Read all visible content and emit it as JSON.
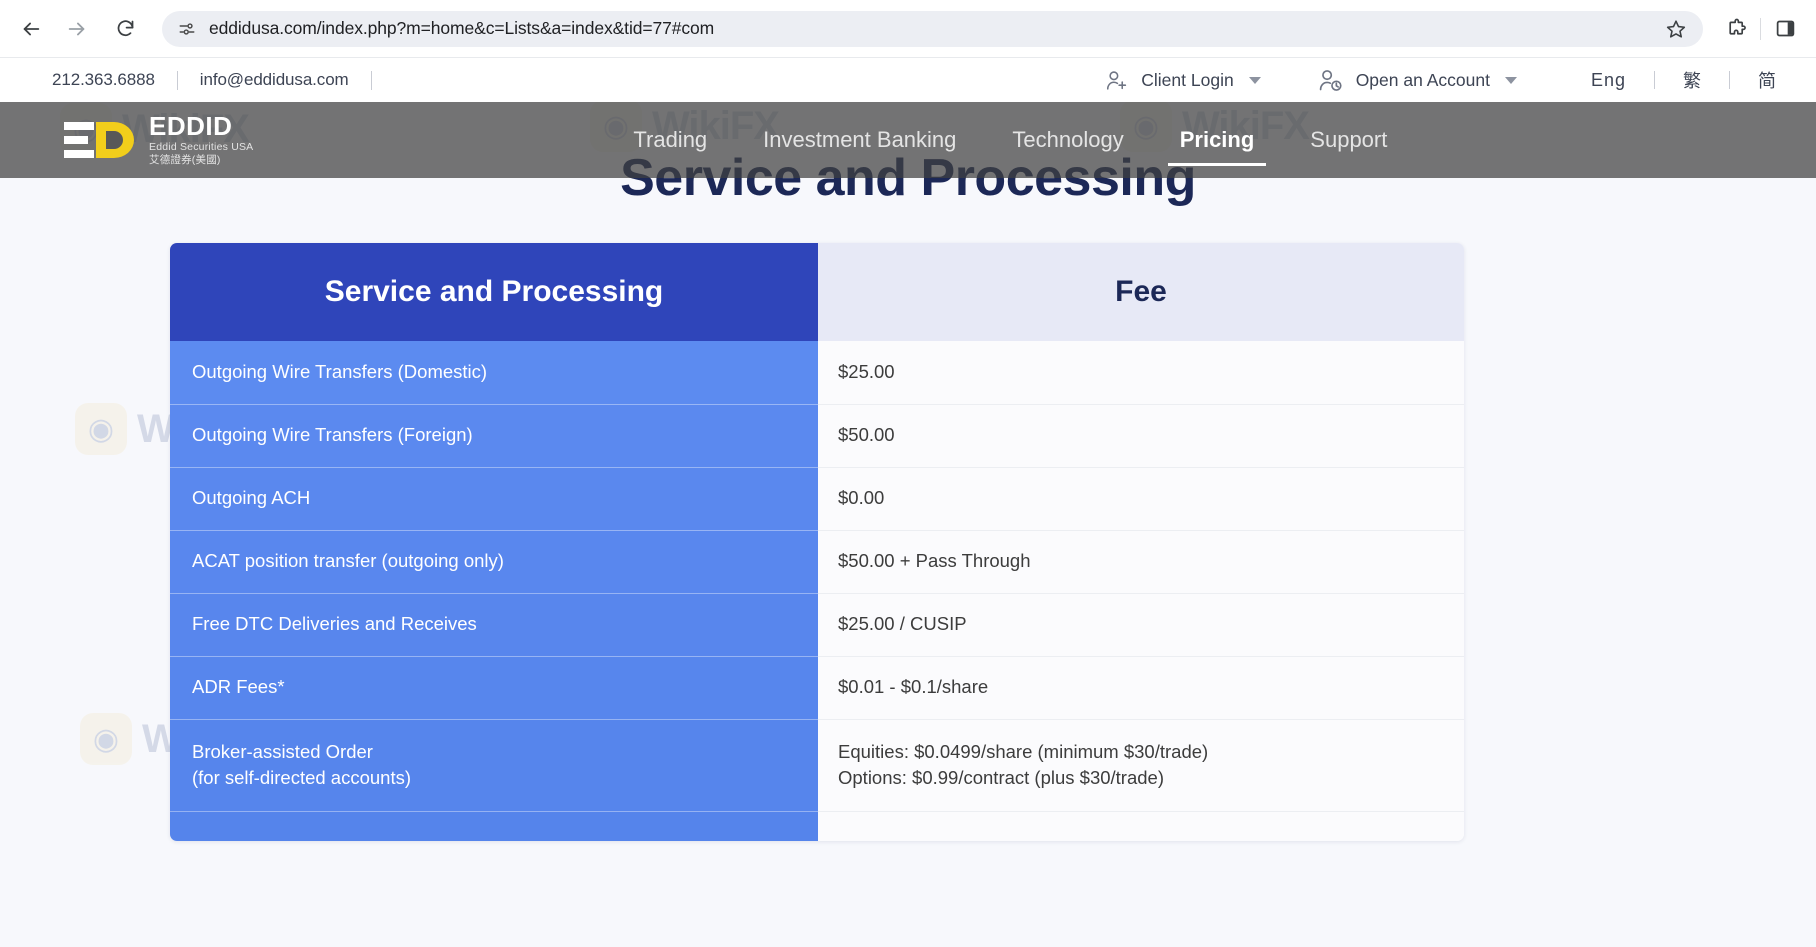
{
  "browser": {
    "url": "eddidusa.com/index.php?m=home&c=Lists&a=index&tid=77#com",
    "back_label": "Back",
    "forward_label": "Forward",
    "reload_label": "Reload",
    "site_info_label": "View site information",
    "bookmark_label": "Bookmark this tab",
    "extensions_label": "Extensions",
    "side_panel_label": "Side panel"
  },
  "utility_bar": {
    "phone": "212.363.6888",
    "email": "info@eddidusa.com",
    "client_login": "Client Login",
    "open_account": "Open an Account",
    "languages": [
      {
        "code": "eng",
        "label": "Eng"
      },
      {
        "code": "trad",
        "label": "繁"
      },
      {
        "code": "simp",
        "label": "简"
      }
    ]
  },
  "header": {
    "logo": {
      "name": "EDDID",
      "sub_en": "Eddid Securities USA",
      "sub_zh": "艾德證券(美國)"
    },
    "nav": [
      {
        "label": "Trading",
        "active": false
      },
      {
        "label": "Investment Banking",
        "active": false
      },
      {
        "label": "Technology",
        "active": false
      },
      {
        "label": "Pricing",
        "active": true
      },
      {
        "label": "Support",
        "active": false
      }
    ]
  },
  "hero": {
    "title": "Service and Processing"
  },
  "table": {
    "columns": [
      "Service and Processing",
      "Fee"
    ],
    "rows": [
      {
        "service": "Outgoing Wire Transfers (Domestic)",
        "fee": [
          "$25.00"
        ]
      },
      {
        "service": "Outgoing Wire Transfers (Foreign)",
        "fee": [
          "$50.00"
        ]
      },
      {
        "service": "Outgoing ACH",
        "fee": [
          "$0.00"
        ]
      },
      {
        "service": "ACAT position transfer (outgoing only)",
        "fee": [
          "$50.00 + Pass Through"
        ]
      },
      {
        "service": "Free DTC Deliveries and Receives",
        "fee": [
          "$25.00 / CUSIP"
        ]
      },
      {
        "service": "ADR Fees*",
        "fee": [
          "$0.01 - $0.1/share"
        ]
      },
      {
        "service_lines": [
          "Broker-assisted Order",
          "(for self-directed accounts)"
        ],
        "fee": [
          "Equities: $0.0499/share (minimum $30/trade)",
          "Options: $0.99/contract (plus $30/trade)"
        ]
      }
    ]
  },
  "watermark": {
    "text": "WikiFX",
    "glyph": "◉"
  },
  "colors": {
    "header_blue": "#2f45ba",
    "row_blue": "#5c8bf0",
    "fee_header_bg": "#e7e9f6",
    "hero_navy": "#1c2857",
    "page_bg": "#f7f8fc",
    "site_header_overlay": "rgba(64,64,64,0.72)",
    "logo_yellow": "#f2ce1b"
  }
}
